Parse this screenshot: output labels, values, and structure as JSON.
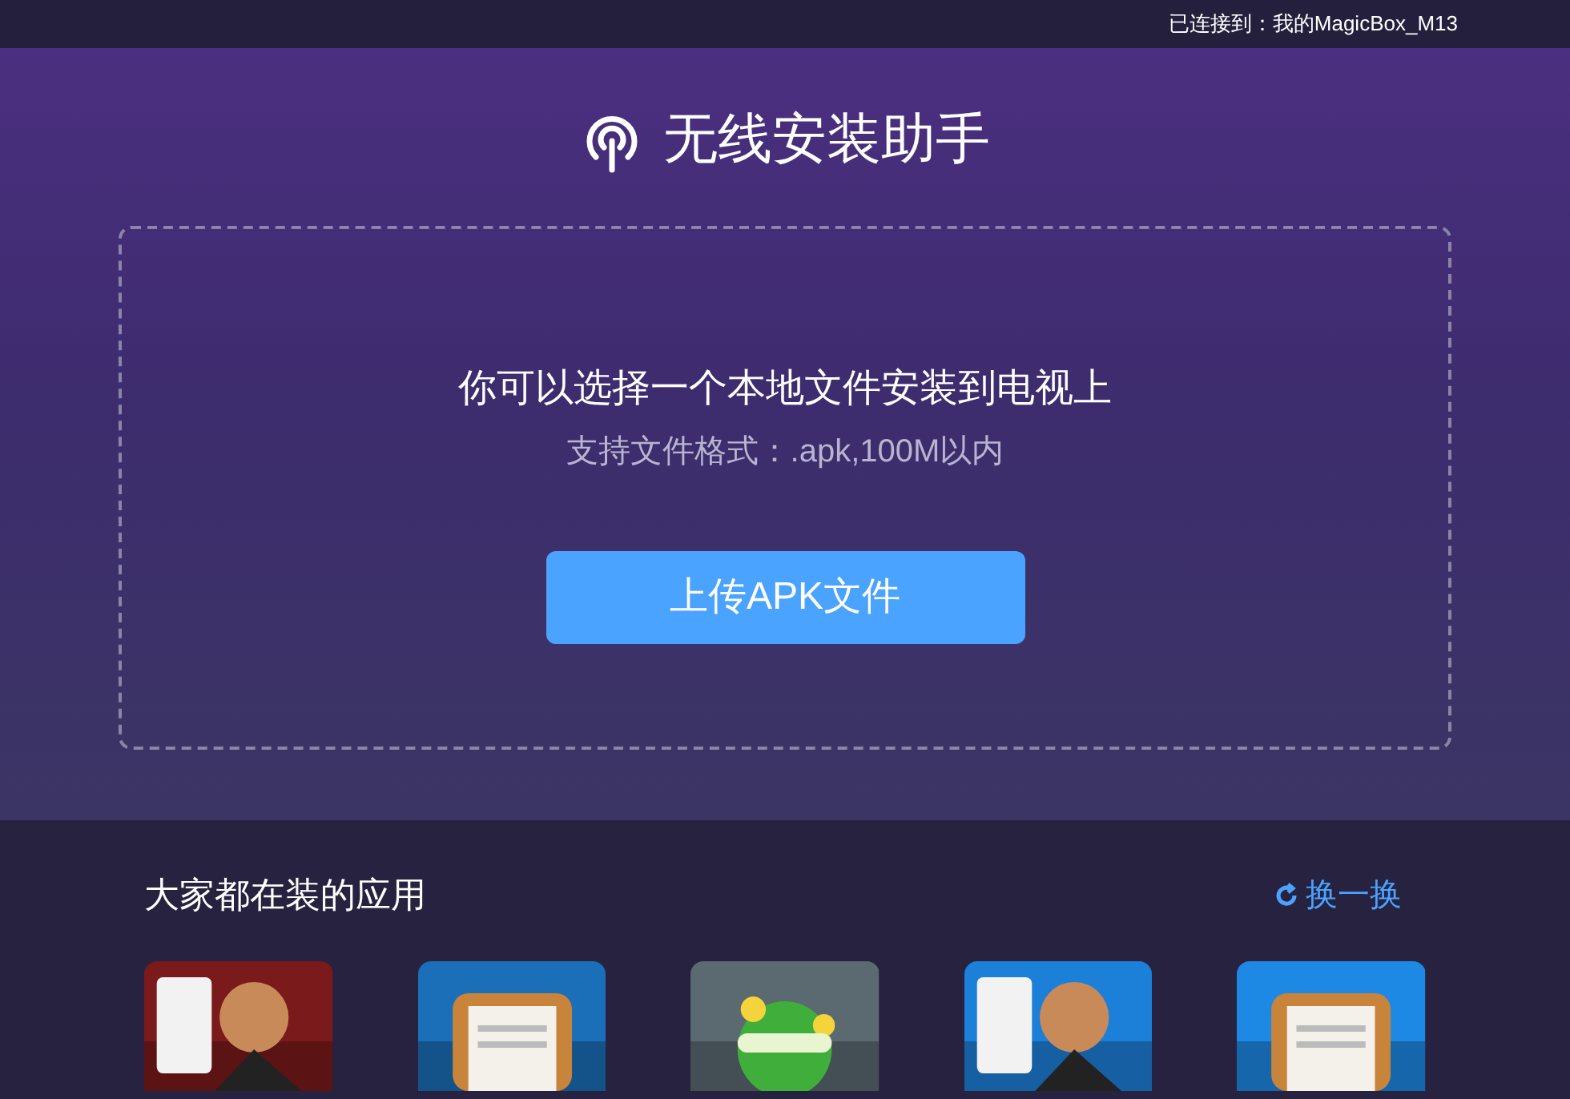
{
  "status_bar": {
    "connection": "已连接到：我的MagicBox_M13"
  },
  "header": {
    "title": "无线安装助手"
  },
  "upload": {
    "message": "你可以选择一个本地文件安装到电视上",
    "hint": "支持文件格式：.apk,100M以内",
    "button": "上传APK文件"
  },
  "popular": {
    "title": "大家都在装的应用",
    "refresh": "换一换"
  }
}
